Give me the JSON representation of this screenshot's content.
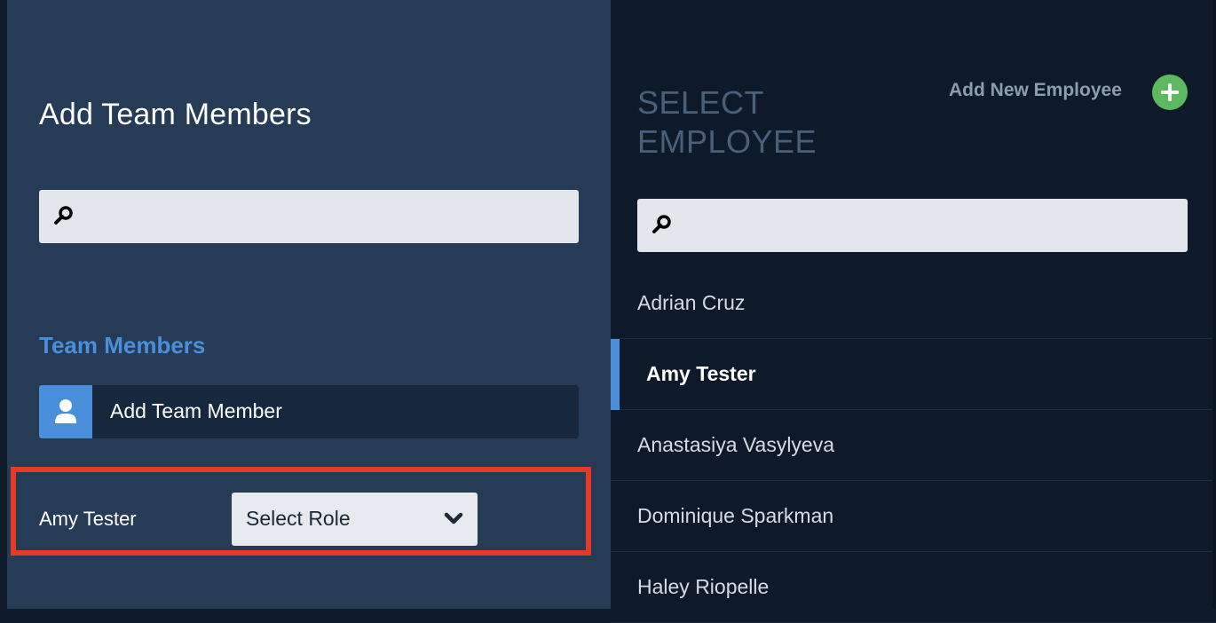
{
  "left_panel": {
    "title": "Add Team Members",
    "search": {
      "placeholder": "",
      "value": ""
    },
    "section_title": "Team Members",
    "add_member_label": "Add Team Member",
    "members": [
      {
        "name": "Amy Tester",
        "role_select": "Select Role"
      }
    ]
  },
  "right_panel": {
    "title": "SELECT EMPLOYEE",
    "add_new_label": "Add New Employee",
    "search": {
      "placeholder": "",
      "value": ""
    },
    "employees": [
      {
        "name": "Adrian Cruz",
        "selected": false
      },
      {
        "name": "Amy Tester",
        "selected": true
      },
      {
        "name": "Anastasiya Vasylyeva",
        "selected": false
      },
      {
        "name": "Dominique Sparkman",
        "selected": false
      },
      {
        "name": "Haley Riopelle",
        "selected": false
      }
    ]
  },
  "colors": {
    "left_panel_bg": "#263b56",
    "right_panel_bg": "#0e1a29",
    "accent_blue": "#4a8fdb",
    "add_green": "#5cb95e",
    "highlight_red": "#e53a26"
  },
  "icons": {
    "search": "search-icon",
    "user": "user-icon",
    "dropdown": "chevron-down-icon",
    "add": "plus-icon"
  }
}
